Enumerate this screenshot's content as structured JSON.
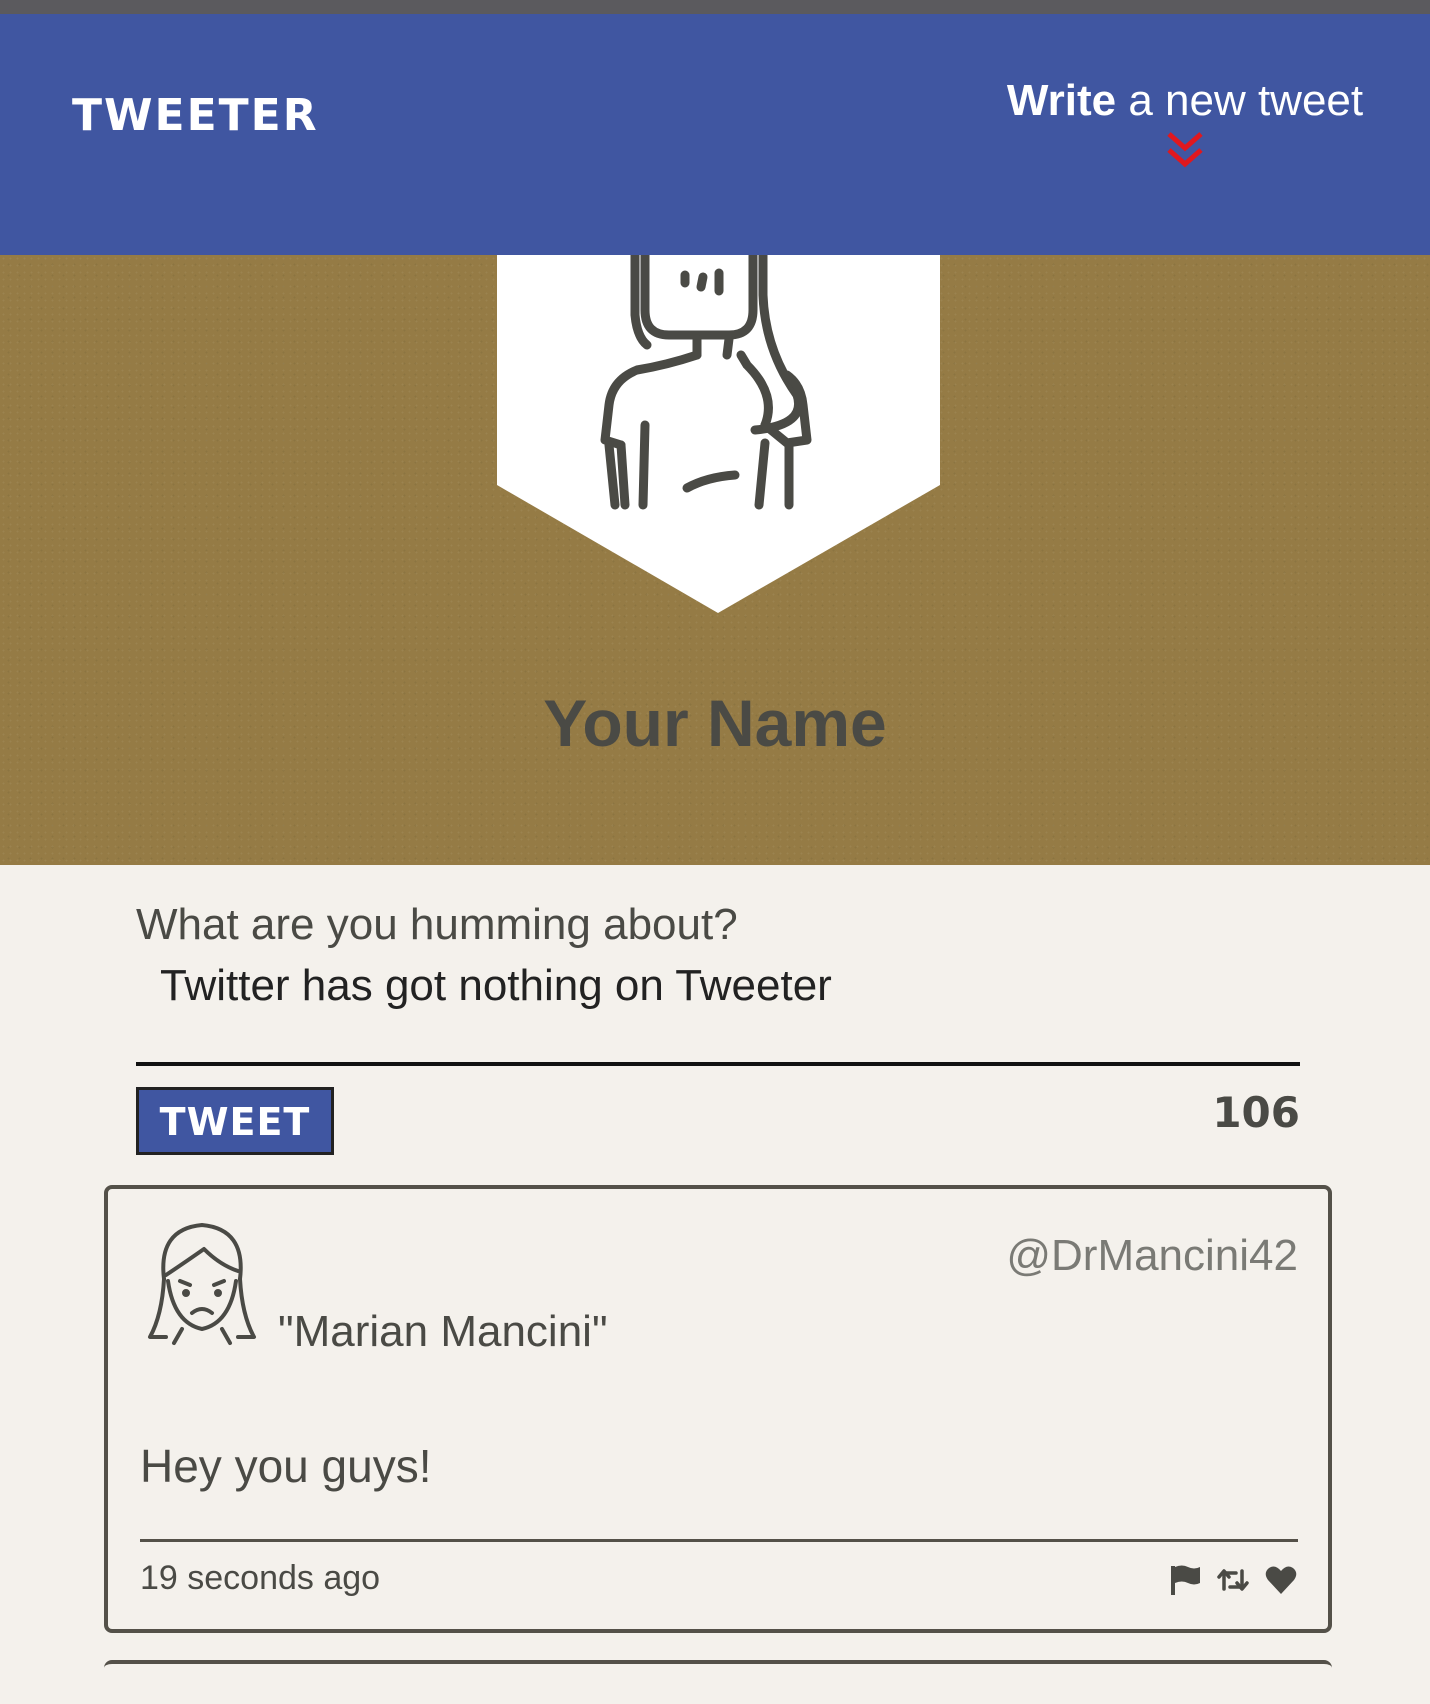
{
  "nav": {
    "brand": "TWEETER",
    "compose_bold": "Write",
    "compose_rest": " a new tweet"
  },
  "profile": {
    "name": "Your Name"
  },
  "composer": {
    "label": "What are you humming about?",
    "value": "Twitter has got nothing on Tweeter",
    "button_label": "TWEET",
    "counter": "106"
  },
  "tweets": [
    {
      "display_name": "\"Marian Mancini\"",
      "handle": "@DrMancini42",
      "body": "Hey you guys!",
      "time": "19 seconds ago"
    }
  ],
  "colors": {
    "nav_bg": "#4056a1",
    "profile_bg": "#957b45",
    "page_bg": "#f4f1ec",
    "text_dark": "#4a4a45",
    "chevron": "#e0181e"
  },
  "icons": [
    "chevron-double-down-icon",
    "avatar-icon",
    "flag-icon",
    "retweet-icon",
    "heart-icon"
  ]
}
